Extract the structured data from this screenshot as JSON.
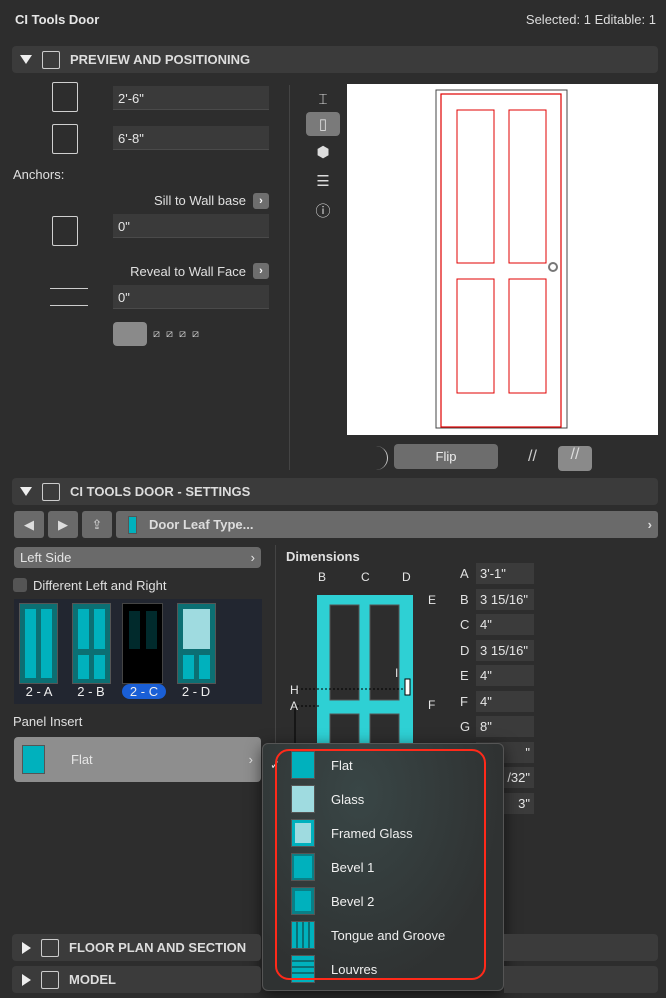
{
  "window": {
    "title": "CI Tools Door",
    "selection_status": "Selected: 1 Editable: 1"
  },
  "preview": {
    "header": "PREVIEW AND POSITIONING",
    "width": "2'-6\"",
    "height": "6'-8\"",
    "anchors_label": "Anchors:",
    "sill_label": "Sill to Wall base",
    "sill_value": "0\"",
    "reveal_label": "Reveal to Wall Face",
    "reveal_value": "0\"",
    "flip_label": "Flip",
    "side_icons": [
      "floor-plan-icon",
      "door-front-icon",
      "3d-cube-icon",
      "section-icon",
      "info-icon"
    ]
  },
  "settings": {
    "header": "CI TOOLS DOOR - SETTINGS",
    "page_select": "Door Leaf Type...",
    "side_select": "Left Side",
    "different_lr_label": "Different Left and Right",
    "different_lr_checked": false,
    "leaf_types": [
      {
        "label": "2 - A"
      },
      {
        "label": "2 - B"
      },
      {
        "label": "2 - C",
        "selected": true
      },
      {
        "label": "2 - D"
      }
    ],
    "panel_insert_label": "Panel Insert",
    "panel_insert_value": "Flat",
    "dimensions_title": "Dimensions",
    "dimensions": [
      {
        "k": "A",
        "v": "3'-1\""
      },
      {
        "k": "B",
        "v": "3 15/16\""
      },
      {
        "k": "C",
        "v": "4\""
      },
      {
        "k": "D",
        "v": "3 15/16\""
      },
      {
        "k": "E",
        "v": "4\""
      },
      {
        "k": "F",
        "v": "4\""
      },
      {
        "k": "G",
        "v": "8\""
      },
      {
        "k": "H",
        "v": "\""
      },
      {
        "k": "I",
        "v": "/32\""
      },
      {
        "k": "J",
        "v": "3\""
      }
    ],
    "diagram_labels": [
      "B",
      "C",
      "D",
      "E",
      "I",
      "H",
      "A",
      "F"
    ]
  },
  "insert_menu": {
    "items": [
      {
        "label": "Flat",
        "checked": true
      },
      {
        "label": "Glass"
      },
      {
        "label": "Framed Glass"
      },
      {
        "label": "Bevel 1"
      },
      {
        "label": "Bevel 2"
      },
      {
        "label": "Tongue and Groove"
      },
      {
        "label": "Louvres"
      }
    ],
    "highlight_color": "#ff2a1a"
  },
  "sections": {
    "floor_plan": "FLOOR PLAN AND SECTION",
    "model": "MODEL"
  },
  "colors": {
    "accent_cyan": "#00b1bd",
    "selected_blue": "#1a5fd6",
    "door_line_red": "#e00000"
  }
}
